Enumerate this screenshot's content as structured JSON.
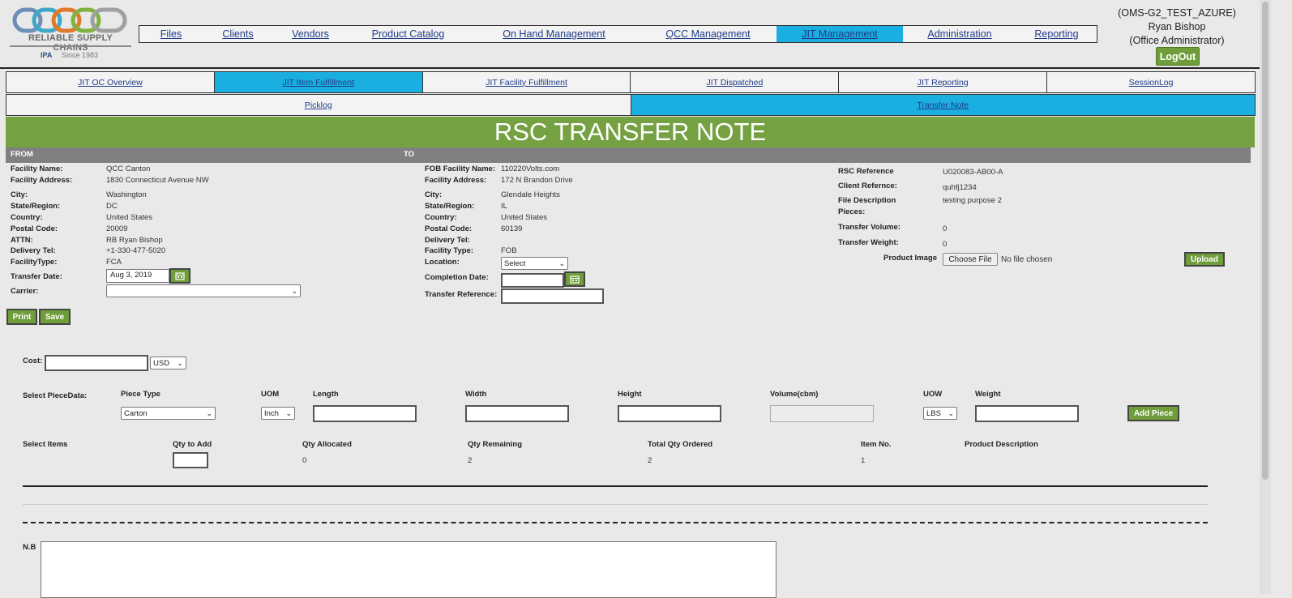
{
  "logo": {
    "brand": "RELIABLE SUPPLY CHAINS",
    "since": "Since 1983",
    "mark": "IPA"
  },
  "nav": {
    "items": [
      "Files",
      "Clients",
      "Vendors",
      "Product Catalog",
      "On Hand Management",
      "QCC Management",
      "JIT Management",
      "Administration",
      "Reporting"
    ],
    "active": "JIT Management"
  },
  "user": {
    "env": "(OMS-G2_TEST_AZURE)",
    "name": "Ryan Bishop",
    "role": "(Office Administrator)",
    "logout": "LogOut"
  },
  "subnav": {
    "row1": [
      "JIT OC Overview",
      "JIT Item Fulfillment",
      "JIT Facility Fulfillment",
      "JIT Dispatched",
      "JIT Reporting",
      "SessionLog"
    ],
    "row1_active": "JIT Item Fulfillment",
    "row2": [
      "Picklog",
      "Transfer Note"
    ],
    "row2_active": "Transfer Note"
  },
  "title": "RSC TRANSFER NOTE",
  "from_label": "FROM",
  "to_label": "TO",
  "from": {
    "fields": [
      {
        "label": "Facility Name:",
        "value": "QCC Canton"
      },
      {
        "label": "Facility Address:",
        "value": "1830 Connecticut Avenue NW"
      },
      {
        "label": "City:",
        "value": "Washington"
      },
      {
        "label": "State/Region:",
        "value": "DC"
      },
      {
        "label": "Country:",
        "value": "United States"
      },
      {
        "label": "Postal Code:",
        "value": "20009"
      },
      {
        "label": "ATTN:",
        "value": "RB Ryan Bishop"
      },
      {
        "label": "Delivery Tel:",
        "value": "+1-330-477-5020"
      },
      {
        "label": "FacilityType:",
        "value": "FCA"
      }
    ],
    "transfer_date_label": "Transfer Date:",
    "transfer_date": "Aug 3, 2019",
    "carrier_label": "Carrier:",
    "carrier_value": ""
  },
  "to": {
    "fields": [
      {
        "label": "FOB Facility Name:",
        "value": "110220Volts.com"
      },
      {
        "label": "Facility Address:",
        "value": "172 N Brandon Drive"
      },
      {
        "label": "City:",
        "value": "Glendale Heights"
      },
      {
        "label": "State/Region:",
        "value": "IL"
      },
      {
        "label": "Country:",
        "value": "United States"
      },
      {
        "label": "Postal Code:",
        "value": "60139"
      },
      {
        "label": "Delivery Tel:",
        "value": ""
      },
      {
        "label": "Facility Type:",
        "value": "FOB"
      }
    ],
    "location_label": "Location:",
    "location_value": "Select",
    "completion_date_label": "Completion Date:",
    "completion_date": "",
    "transfer_ref_label": "Transfer Reference:",
    "transfer_ref": ""
  },
  "info": {
    "fields": [
      {
        "label": "RSC Reference",
        "value": "U020083-AB00-A"
      },
      {
        "label": "Client Refernce:",
        "value": "quhfj1234"
      },
      {
        "label": "File Description",
        "value": "testing purpose 2"
      },
      {
        "label": "Pieces:",
        "value": ""
      },
      {
        "label": "Transfer Volume:",
        "value": "0"
      },
      {
        "label": "Transfer Weight:",
        "value": "0"
      }
    ],
    "product_image_label": "Product Image",
    "choose_file": "Choose File",
    "no_file": "No file chosen",
    "upload": "Upload"
  },
  "actions": {
    "print": "Print",
    "save": "Save"
  },
  "cost": {
    "label": "Cost:",
    "value": "",
    "currency": "USD"
  },
  "piece": {
    "row_label": "Select PieceData:",
    "piece_type_label": "Piece Type",
    "piece_type": "Carton",
    "uom_label": "UOM",
    "uom": "Inch",
    "length_label": "Length",
    "width_label": "Width",
    "height_label": "Height",
    "volume_label": "Volume(cbm)",
    "uow_label": "UOW",
    "uow": "LBS",
    "weight_label": "Weight",
    "add_piece": "Add Piece"
  },
  "items": {
    "headers": [
      "Select Items",
      "Qty to Add",
      "Qty Allocated",
      "Qty Remaining",
      "Total Qty Ordered",
      "Item No.",
      "Product Description"
    ],
    "row": {
      "qty_allocated": "0",
      "qty_remaining": "2",
      "total_qty_ordered": "2",
      "item_no": "1",
      "product_description": ""
    }
  },
  "nb": {
    "label": "N.B",
    "value": ""
  },
  "colors": {
    "accent_green": "#75a142",
    "active_blue": "#1aafe0",
    "button_green": "#6e9d3a"
  }
}
